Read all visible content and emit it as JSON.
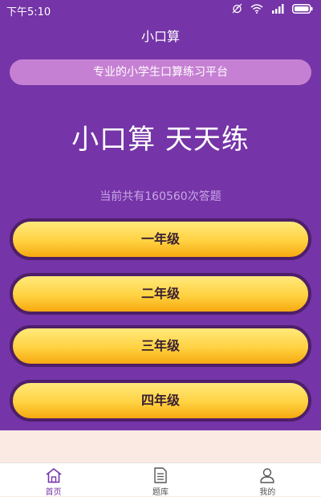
{
  "status_bar": {
    "time": "下午5:10"
  },
  "app": {
    "title": "小口算"
  },
  "banner": {
    "text": "专业的小学生口算练习平台"
  },
  "hero": {
    "title": "小口算 天天练"
  },
  "stats": {
    "text": "当前共有160560次答题"
  },
  "grades": [
    {
      "label": "一年级"
    },
    {
      "label": "二年级"
    },
    {
      "label": "三年级"
    },
    {
      "label": "四年级"
    }
  ],
  "tabbar": {
    "items": [
      {
        "label": "首页",
        "icon": "home-icon",
        "active": true
      },
      {
        "label": "题库",
        "icon": "document-icon",
        "active": false
      },
      {
        "label": "我的",
        "icon": "user-icon",
        "active": false
      }
    ]
  },
  "colors": {
    "primary": "#7534a7",
    "banner": "#c680d3",
    "button": "#ffd241",
    "button_border": "#4e1f69",
    "bottom_area": "#fbe9e3"
  }
}
